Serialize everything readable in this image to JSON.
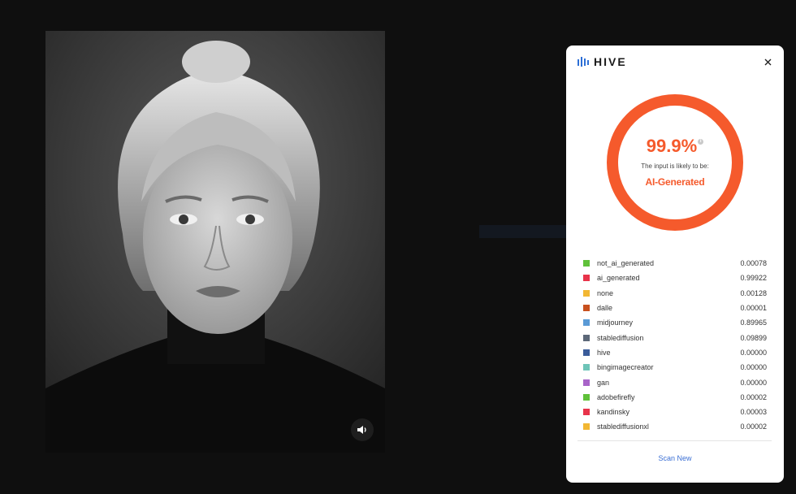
{
  "viewer": {
    "image_icon": "portrait-photo",
    "sound_icon": "speaker-icon"
  },
  "panel": {
    "brand": "HIVE",
    "brand_icon": "hive-logo-icon",
    "close_icon": "close-icon",
    "score": "99.9%",
    "likely_text": "The input is likely to be:",
    "verdict": "AI-Generated",
    "accent_color": "#f55a2c",
    "classes": [
      {
        "label": "not_ai_generated",
        "value": "0.00078",
        "color": "#5fc13a"
      },
      {
        "label": "ai_generated",
        "value": "0.99922",
        "color": "#e8334a"
      },
      {
        "label": "none",
        "value": "0.00128",
        "color": "#f2b733"
      },
      {
        "label": "dalle",
        "value": "0.00001",
        "color": "#c8501e"
      },
      {
        "label": "midjourney",
        "value": "0.89965",
        "color": "#5a9ad6"
      },
      {
        "label": "stablediffusion",
        "value": "0.09899",
        "color": "#5c6878"
      },
      {
        "label": "hive",
        "value": "0.00000",
        "color": "#3a5c9a"
      },
      {
        "label": "bingimagecreator",
        "value": "0.00000",
        "color": "#6ec4b8"
      },
      {
        "label": "gan",
        "value": "0.00000",
        "color": "#a864c8"
      },
      {
        "label": "adobefirefly",
        "value": "0.00002",
        "color": "#5fc13a"
      },
      {
        "label": "kandinsky",
        "value": "0.00003",
        "color": "#e8334a"
      },
      {
        "label": "stablediffusionxl",
        "value": "0.00002",
        "color": "#f2b733"
      }
    ],
    "scan_button": "Scan New"
  }
}
